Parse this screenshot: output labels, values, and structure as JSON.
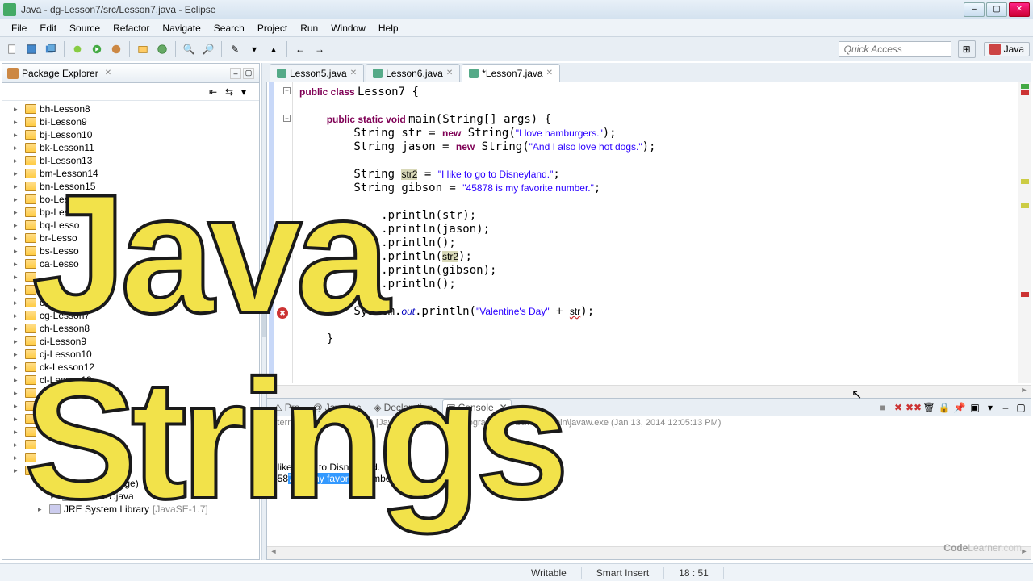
{
  "window": {
    "title": "Java - dg-Lesson7/src/Lesson7.java - Eclipse"
  },
  "menu": [
    "File",
    "Edit",
    "Source",
    "Refactor",
    "Navigate",
    "Search",
    "Project",
    "Run",
    "Window",
    "Help"
  ],
  "quick_access": "Quick Access",
  "perspective": "Java",
  "package_explorer": {
    "title": "Package Explorer",
    "items": [
      "bh-Lesson8",
      "bi-Lesson9",
      "bj-Lesson10",
      "bk-Lesson11",
      "bl-Lesson13",
      "bm-Lesson14",
      "bn-Lesson15",
      "bo-Lesso",
      "bp-Lesso",
      "bq-Lesso",
      "br-Lesso",
      "bs-Lesso",
      "ca-Lesso",
      "",
      "",
      "cf-Lesson6",
      "cg-Lesson7",
      "ch-Lesson8",
      "ci-Lesson9",
      "cj-Lesson10",
      "ck-Lesson12",
      "cl-Lesson13",
      "cm-",
      "",
      "",
      "",
      "",
      "",
      ""
    ],
    "expanded_pkg": "(default package)",
    "expanded_file": "Lesson7.java",
    "jre": "JRE System Library",
    "jre_env": "[JavaSE-1.7]"
  },
  "editor": {
    "tabs": [
      {
        "label": "Lesson5.java",
        "active": false
      },
      {
        "label": "Lesson6.java",
        "active": false
      },
      {
        "label": "*Lesson7.java",
        "active": true
      }
    ],
    "code": {
      "l1": {
        "pre": "public class ",
        "cls": "Lesson7",
        "post": " {"
      },
      "l2": {
        "pre": "    public static void ",
        "m": "main",
        "post": "(String[] args) {"
      },
      "l3": {
        "a": "        String str = ",
        "kw": "new",
        "b": " String(",
        "s": "\"I love hamburgers.\"",
        "c": ");"
      },
      "l4": {
        "a": "        String jason = ",
        "kw": "new",
        "b": " String(",
        "s": "\"And I also love hot dogs.\"",
        "c": ");"
      },
      "l5": "",
      "l6": {
        "a": "        String ",
        "v": "str2",
        "b": " = ",
        "s": "\"I like to go to Disneyland.\"",
        "c": ";"
      },
      "l7": {
        "a": "        String gibson = ",
        "s": "\"45878 is my favorite number.\"",
        "c": ";"
      },
      "l8": "",
      "l9": {
        "p": "            ",
        "m": ".println(str);"
      },
      "l10": {
        "p": "            ",
        "m": ".println(jason);"
      },
      "l11": {
        "p": "            ",
        "m": ".println();"
      },
      "l12": {
        "p": "            ",
        "m": ".println(",
        "v": "str2",
        "c": ");"
      },
      "l13": {
        "p": "            ",
        "m": ".println(gibson);"
      },
      "l14": {
        "p": "            ",
        "m": ".println();"
      },
      "l15": "",
      "l16": {
        "a": "        System.",
        "o": "out",
        "b": ".println(",
        "s": "\"Valentine's Day\"",
        "c": " + ",
        "v": "str",
        "d": ");"
      },
      "l17": "",
      "l18": "    }"
    }
  },
  "console": {
    "tabs": [
      "Pro",
      "Javadoc",
      "Declaration",
      "Console"
    ],
    "info": "<terminated> Lesson7 (3) [Java Application] C:\\Program Files\\Java\\jre7\\bin\\javaw.exe (Jan 13, 2014 12:05:13 PM)",
    "line_a": "I like to go to Disneyland.",
    "line_b_pre": "458",
    "line_b_sel": "78 is my favorite nu",
    "line_b_post": "mber."
  },
  "status": {
    "writable": "Writable",
    "insert": "Smart Insert",
    "pos": "18 : 51"
  },
  "overlay": {
    "line1": "Java",
    "line2": "Strings"
  },
  "watermark": {
    "a": "Code",
    "b": "Learner",
    "c": ".com"
  }
}
